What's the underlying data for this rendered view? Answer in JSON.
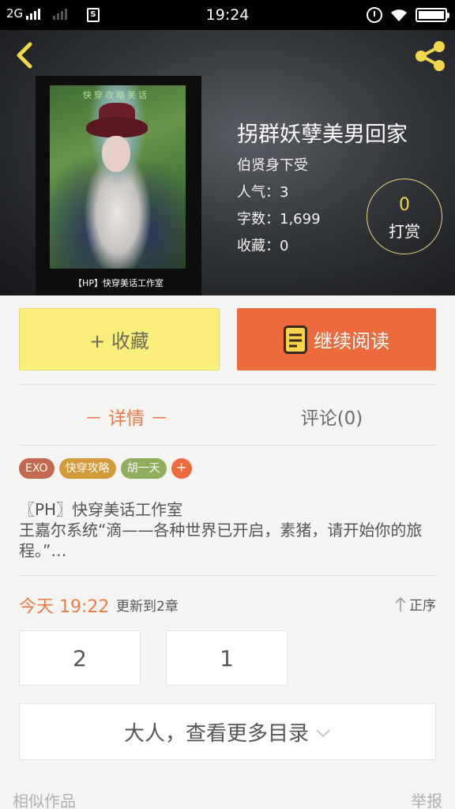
{
  "status_bar": {
    "network": "2G",
    "time": "19:24"
  },
  "header": {
    "cover_caption": "【HP】快穿美话工作室",
    "cover_title": "快穿攻略美话",
    "title": "拐群妖孽美男回家",
    "author": "伯贤身下受",
    "popularity": "人气：3",
    "word_count": "字数：1,699",
    "favorites": "收藏：0",
    "tip_count": "0",
    "tip_label": "打赏"
  },
  "actions": {
    "favorite_label": "+ 收藏",
    "read_label": "继续阅读"
  },
  "tabs": {
    "detail": "－ 详情 －",
    "comments": "评论(0)"
  },
  "tags": [
    {
      "label": "EXO",
      "color": "#c3694f"
    },
    {
      "label": "快穿攻略",
      "color": "#d39a3a"
    },
    {
      "label": "胡一天",
      "color": "#8fae5c"
    }
  ],
  "tag_add": "+",
  "description": {
    "line1": "〖PH〗快穿美话工作室",
    "line2": "王嘉尔系统“滴——各种世界已开启，素猪，请开始你的旅程。”…"
  },
  "update": {
    "time": "今天 19:22",
    "text": "更新到2章",
    "sort_label": "正序"
  },
  "chapters": [
    "2",
    "1"
  ],
  "more_catalog": "大人，查看更多目录",
  "footer": {
    "similar": "相似作品",
    "report": "举报"
  },
  "colors": {
    "accent": "#ec6a3c",
    "favorite_bg": "#f9ef7a",
    "tip_number": "#f2d64b"
  }
}
